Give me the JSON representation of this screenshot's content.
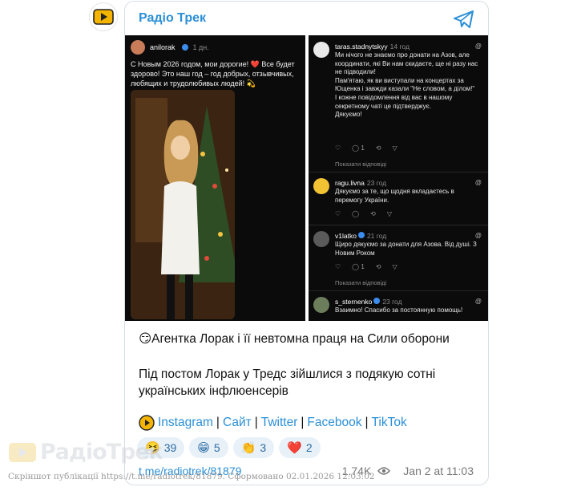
{
  "channel": {
    "name": "Радіо Трек",
    "avatar_icon": "play-logo-icon"
  },
  "left_screenshot": {
    "username": "anilorak",
    "time": "1 дн.",
    "text": "С Новым 2026 годом, мои дорогие! ❤️ Все будет здорово! Это наш год – год добрых, отзывчивых, любящих и трудолюбивых людей! 💫"
  },
  "comments": [
    {
      "user": "taras.stadnytskyy",
      "time": "14 год",
      "text": "Ми нічого не знаємо про донати на Азов, але координати, які Ви нам скидаєте, ще ні разу нас не підводили!\nПам'ятаю, як ви виступали на концертах за Ющенка і завжди казали \"Не словом, а ділом!\"\nІ кожне повідомлення від вас в нашому секретному чаті це підтверджує.\nДякуємо!",
      "likes": "",
      "replies": "1",
      "show_replies": "Показати відповіді"
    },
    {
      "user": "ragu.livna",
      "time": "23 год",
      "text": "Дякуємо за те, що щодня вкладаєтесь в перемогу України.",
      "likes": "",
      "replies": "",
      "show_replies": ""
    },
    {
      "user": "v1latko",
      "time": "21 год",
      "text": "Щиро дякуємо за донати для Азова. Від душі. З Новим Роком",
      "likes": "",
      "replies": "1",
      "show_replies": "Показати відповіді"
    },
    {
      "user": "s_sternenko",
      "time": "23 год",
      "text": "Взаимно! Спасибо за постоянную помощь!"
    }
  ],
  "post": {
    "title": "😏Агентка Лорак і її невтомна праця на Сили оборони",
    "description": "Під постом Лорак у Тредс зійшлися з подякую сотні українських інфлюенсерів",
    "links": [
      "Instagram",
      "Сайт",
      "Twitter",
      "Facebook",
      "TikTok"
    ],
    "separator": "|"
  },
  "reactions": [
    {
      "emoji": "🤧",
      "count": "39"
    },
    {
      "emoji": "😁",
      "count": "5"
    },
    {
      "emoji": "👏",
      "count": "3"
    },
    {
      "emoji": "❤️",
      "count": "2"
    }
  ],
  "footer": {
    "link": "t.me/radiotrek/81879",
    "views": "1.74K",
    "date": "Jan 2 at 11:03"
  },
  "watermark": {
    "logo_text": "РадіоТрек",
    "caption": "Скріншот публікації https://t.me/radiotrek/81879. Сформовано 02.01.2026 12:03:02"
  },
  "colors": {
    "accent": "#2b8fd6",
    "reaction_bg": "#e8f0f8",
    "dark_bg": "#0b0b0b"
  }
}
